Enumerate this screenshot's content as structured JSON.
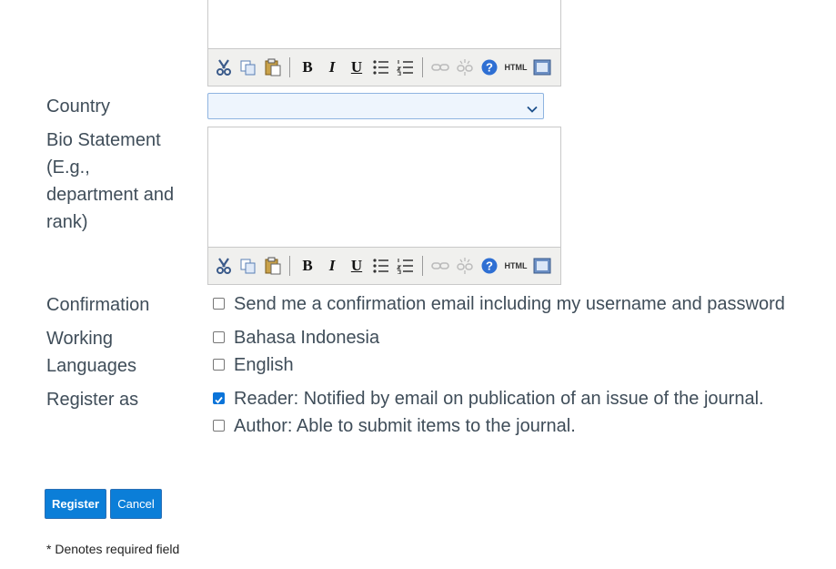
{
  "fields": {
    "country_label": "Country",
    "country_value": "",
    "bio_label_lines": [
      "Bio Statement",
      "(E.g.,",
      "department and",
      "rank)"
    ],
    "confirmation_label": "Confirmation",
    "confirmation_option": "Send me a confirmation email including my username and password",
    "working_label_lines": [
      "Working",
      "Languages"
    ],
    "languages": [
      "Bahasa Indonesia",
      "English"
    ],
    "register_as_label": "Register as",
    "register_options": [
      {
        "text": "Reader: Notified by email on publication of an issue of the journal.",
        "checked": true
      },
      {
        "text": "Author: Able to submit items to the journal.",
        "checked": false
      }
    ]
  },
  "toolbar_icons": [
    "cut-icon",
    "copy-icon",
    "paste-icon",
    "bold-icon",
    "italic-icon",
    "underline-icon",
    "bullet-list-icon",
    "numbered-list-icon",
    "link-icon",
    "unlink-icon",
    "help-icon",
    "html-icon",
    "fullscreen-icon"
  ],
  "toolbar_glyphs": {
    "bold": "B",
    "italic": "I",
    "underline": "U",
    "html": "HTML"
  },
  "buttons": {
    "register": "Register",
    "cancel": "Cancel"
  },
  "footer_note": "* Denotes required field",
  "colors": {
    "accent": "#0b7ed8",
    "text": "#3f4d59"
  }
}
